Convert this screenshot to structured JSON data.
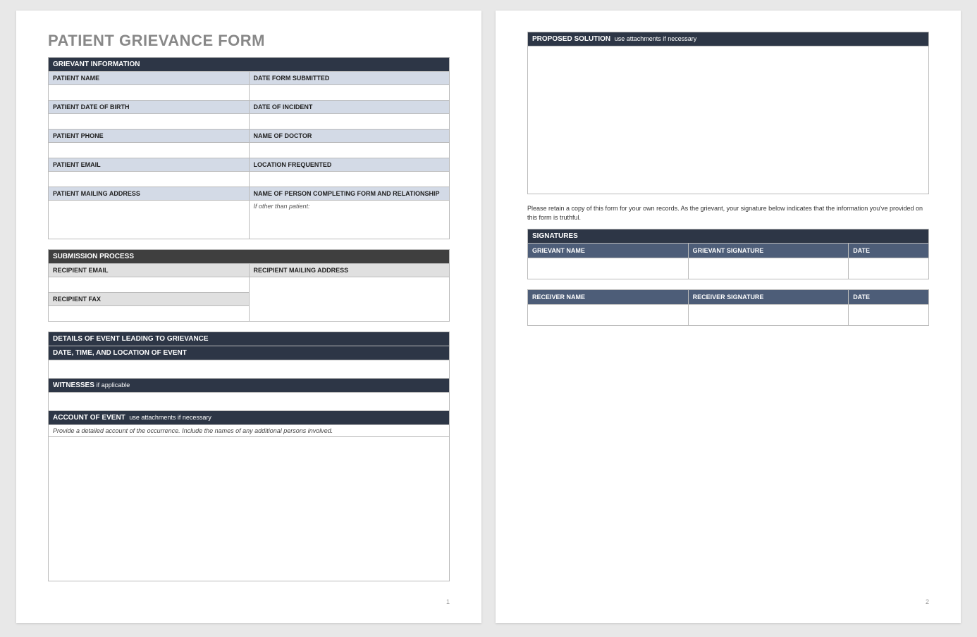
{
  "title": "PATIENT GRIEVANCE FORM",
  "sections": {
    "grievant": {
      "header": "GRIEVANT INFORMATION",
      "rows": [
        [
          "PATIENT NAME",
          "DATE FORM SUBMITTED"
        ],
        [
          "PATIENT DATE OF BIRTH",
          "DATE OF INCIDENT"
        ],
        [
          "PATIENT PHONE",
          "NAME OF DOCTOR"
        ],
        [
          "PATIENT EMAIL",
          "LOCATION FREQUENTED"
        ],
        [
          "PATIENT MAILING ADDRESS",
          "NAME OF PERSON COMPLETING FORM AND RELATIONSHIP"
        ]
      ],
      "if_other": "If other than patient:"
    },
    "submission": {
      "header": "SUBMISSION PROCESS",
      "recipient_email": "RECIPIENT EMAIL",
      "recipient_mailing": "RECIPIENT MAILING ADDRESS",
      "recipient_fax": "RECIPIENT FAX"
    },
    "details": {
      "header": "DETAILS OF EVENT LEADING TO GRIEVANCE",
      "datetime": "DATE, TIME, AND LOCATION OF EVENT",
      "witnesses_label": "WITNESSES",
      "witnesses_sub": "if applicable",
      "account_label": "ACCOUNT OF EVENT",
      "account_sub": "use attachments if necessary",
      "account_hint": "Provide a detailed account of the occurrence.  Include the names of any additional persons involved."
    },
    "solution": {
      "label": "PROPOSED SOLUTION",
      "sub": "use attachments if necessary"
    },
    "retain_note": "Please retain a copy of this form for your own records.  As the grievant, your signature below indicates that the information you've provided on this form is truthful.",
    "signatures": {
      "header": "SIGNATURES",
      "grievant": [
        "GRIEVANT NAME",
        "GRIEVANT SIGNATURE",
        "DATE"
      ],
      "receiver": [
        "RECEIVER NAME",
        "RECEIVER SIGNATURE",
        "DATE"
      ]
    }
  },
  "page_numbers": [
    "1",
    "2"
  ]
}
